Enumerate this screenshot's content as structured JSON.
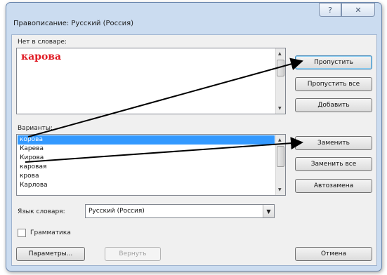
{
  "window": {
    "title": "Правописание: Русский (Россия)",
    "help_glyph": "?",
    "close_glyph": "✕"
  },
  "not_in_dictionary": {
    "label": "Нет в словаре:",
    "word": "карова",
    "word_color": "#e01b24"
  },
  "buttons": {
    "skip": "Пропустить",
    "skip_all": "Пропустить все",
    "add": "Добавить",
    "replace": "Заменить",
    "replace_all": "Заменить все",
    "autocorrect": "Автозамена",
    "options": "Параметры...",
    "undo": "Вернуть",
    "cancel": "Отмена"
  },
  "suggestions": {
    "label": "Варианты:",
    "selected_index": 0,
    "items": [
      "корова",
      "Карева",
      "Кирова",
      "каровая",
      "крова",
      "Карлова"
    ]
  },
  "dictionary": {
    "label": "Язык словаря:",
    "value": "Русский (Россия)"
  },
  "grammar": {
    "label": "Грамматика",
    "checked": false
  },
  "colors": {
    "selection": "#3399ff",
    "frame": "#cbdcf0"
  }
}
